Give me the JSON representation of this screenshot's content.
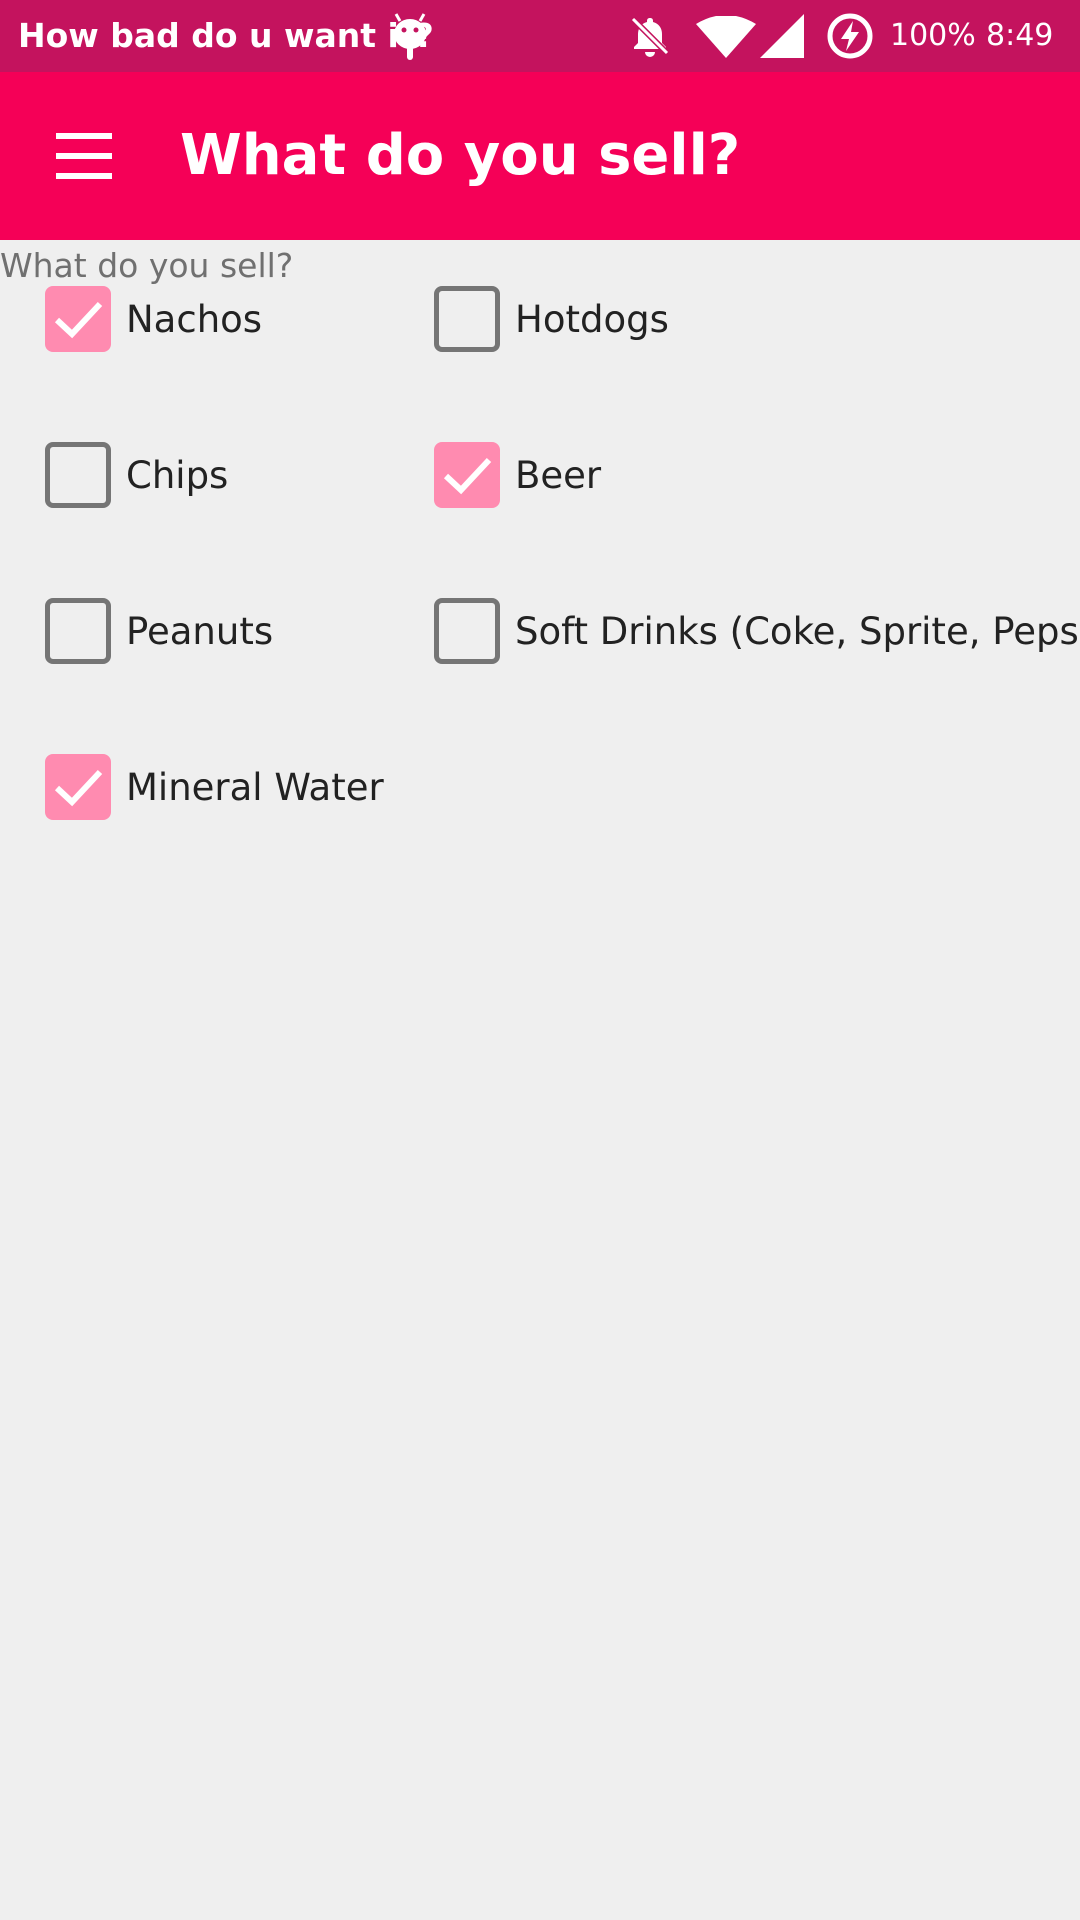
{
  "status_bar": {
    "notification_title": "How bad do u want it?",
    "android_icon": "android-icon",
    "mute_icon": "notifications-off-icon",
    "wifi_icon": "wifi-icon",
    "signal_icon": "cell-signal-icon",
    "battery_icon": "battery-charging-icon",
    "battery": "100%",
    "time": "8:49",
    "background": "#c4135e"
  },
  "app_bar": {
    "title": "What do you sell?",
    "menu_icon": "menu-icon",
    "background": "#f50057"
  },
  "form": {
    "label": "What do you sell?",
    "checked_color": "#ff8bb0",
    "options": [
      {
        "label": "Nachos",
        "checked": true
      },
      {
        "label": "Hotdogs",
        "checked": false
      },
      {
        "label": "Chips",
        "checked": false
      },
      {
        "label": "Beer",
        "checked": true
      },
      {
        "label": "Peanuts",
        "checked": false
      },
      {
        "label": "Soft Drinks (Coke, Sprite, Pepsi)",
        "checked": false
      },
      {
        "label": "Mineral Water",
        "checked": true
      }
    ]
  }
}
